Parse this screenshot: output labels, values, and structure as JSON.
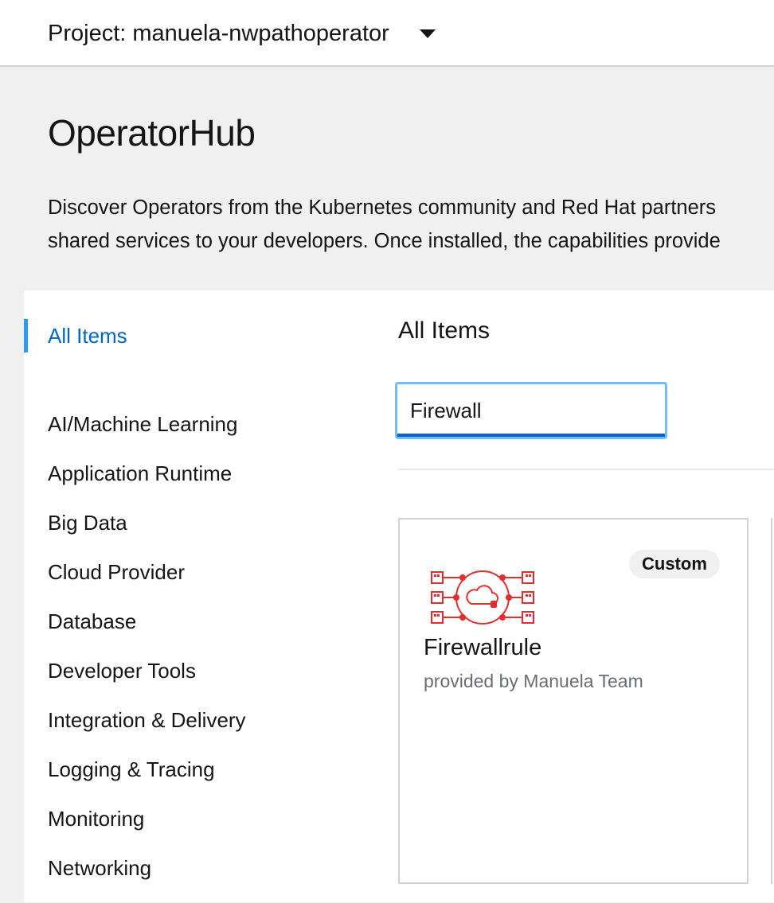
{
  "header": {
    "project_label": "Project: manuela-nwpathoperator"
  },
  "page": {
    "title": "OperatorHub",
    "description_line1": "Discover Operators from the Kubernetes community and Red Hat partners",
    "description_line2": "shared services to your developers. Once installed, the capabilities provide"
  },
  "sidebar": {
    "active": "All Items",
    "categories": [
      "AI/Machine Learning",
      "Application Runtime",
      "Big Data",
      "Cloud Provider",
      "Database",
      "Developer Tools",
      "Integration & Delivery",
      "Logging & Tracing",
      "Monitoring",
      "Networking"
    ]
  },
  "content": {
    "title": "All Items",
    "search": {
      "value": "Firewall"
    }
  },
  "cards": [
    {
      "badge": "Custom",
      "title": "Firewallrule",
      "provider": "provided by Manuela Team",
      "icon": "firewall-cloud-icon",
      "icon_color": "#e52d2d"
    }
  ],
  "colors": {
    "accent": "#0066cc",
    "active_bar": "#2b9af3",
    "focus": "#73bcf7"
  }
}
